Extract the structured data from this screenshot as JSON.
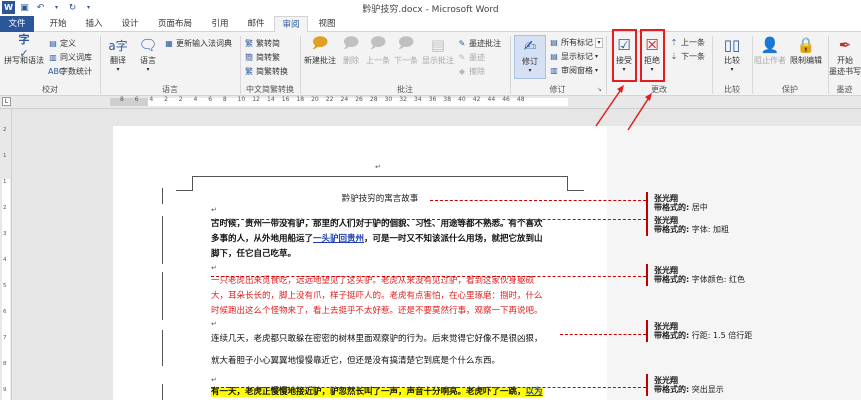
{
  "window": {
    "title": "黔驴技穷.docx - Microsoft Word"
  },
  "tabs": [
    {
      "label": "文件"
    },
    {
      "label": "开始"
    },
    {
      "label": "插入"
    },
    {
      "label": "设计"
    },
    {
      "label": "页面布局"
    },
    {
      "label": "引用"
    },
    {
      "label": "邮件"
    },
    {
      "label": "审阅"
    },
    {
      "label": "视图"
    }
  ],
  "ribbon": {
    "proofing": {
      "spell": "拼写和语法",
      "define": "定义",
      "thesaurus": "同义词库",
      "wordcount": "字数统计",
      "label": "校对"
    },
    "language": {
      "translate": "翻译",
      "language": "语言",
      "label": "语言"
    },
    "ime": {
      "update": "更新输入法词典"
    },
    "chinese": {
      "trad": "繁转简",
      "simp": "简转繁",
      "convert": "简繁转换",
      "label": "中文简繁转换"
    },
    "comments": {
      "new": "新建批注",
      "delete": "删除",
      "prev": "上一条",
      "next": "下一条",
      "show": "显示批注",
      "label": "批注"
    },
    "tracking": {
      "ink1": "墨迹批注",
      "ink2": "墨迹",
      "ink3": "擦除",
      "track": "修订",
      "all_markup": "所有标记",
      "show_markup": "显示标记",
      "pane": "审阅窗格",
      "label": "修订"
    },
    "changes": {
      "accept": "接受",
      "reject": "拒绝",
      "prev": "上一条",
      "next": "下一条",
      "label": "更改"
    },
    "compare": {
      "compare": "比较",
      "label": "比较"
    },
    "protect": {
      "block": "阻止作者",
      "restrict": "限制编辑",
      "label": "保护"
    },
    "ink": {
      "start": "开始",
      "start2": "墨迹书写",
      "label": "墨迹"
    }
  },
  "ruler": {
    "numbers": [
      "8",
      "6",
      "4",
      "2",
      "2",
      "4",
      "6",
      "8",
      "10",
      "12",
      "14",
      "16",
      "18",
      "20",
      "22",
      "24",
      "26",
      "28",
      "30",
      "32",
      "34",
      "36",
      "38",
      "40",
      "42",
      "44",
      "46",
      "48"
    ]
  },
  "vruler": {
    "numbers": [
      "2",
      "1",
      "1",
      "2",
      "3",
      "4",
      "5",
      "6",
      "7",
      "8",
      "9"
    ]
  },
  "document": {
    "title": "黔驴技穷的寓言故事",
    "para1_a": "古时候，贵州一带没有驴，那里的人们对于驴的個貌、习性、用途等都不熟悉。有个喜欢",
    "para1_b_pre": "多事的人，从外地用船运了",
    "para1_b_link": "一头驴回贵州",
    "para1_b_post": "，可是一时又不知该派什么用场，就把它放到山",
    "para1_c": "脚下，任它自己吃草。",
    "para2_a": "一只老虎出来觅食吃，远远地望见了这头驴。老虎从来没有见过驴，看到这家伙身躯硕",
    "para2_b": "大，耳朵长长的，脚上没有爪，样子挺吓人的。老虎有点害怕，在心里琢磨：捌时，什么",
    "para2_c": "时候跑出这么个怪物来了，看上去挺乎不太好惹。还是不要莫然行事，观察一下再说吧。",
    "para3_a": "连续几天，老虎都只敢躲在密密的树林里面观察驴的行为。后来觉得它好像不是很凶狠，",
    "para3_b": "就大着胆子小心翼翼地慢慢靠近它，但还是没有搞清楚它到底是个什么东西。",
    "para4_hl": "有一天，老虎正慢慢地接近驴，驴忽然长叫了一声，声音十分响亮。老虎吓了一跳，",
    "para4_link": "以为",
    "para_mark": "↵"
  },
  "comments": [
    {
      "author": "张光翔",
      "label": "带格式的:",
      "value": "居中"
    },
    {
      "author": "张光翔",
      "label": "带格式的:",
      "value": "字体: 加粗"
    },
    {
      "author": "张光翔",
      "label": "带格式的:",
      "value": "字体颜色: 红色"
    },
    {
      "author": "张光翔",
      "label": "带格式的:",
      "value": "行距: 1.5 倍行距"
    },
    {
      "author": "张光翔",
      "label": "带格式的:",
      "value": "突出显示"
    }
  ],
  "colors": {
    "accent": "#2b579a",
    "highlight_box": "#e02020",
    "track_red": "#e02020"
  }
}
